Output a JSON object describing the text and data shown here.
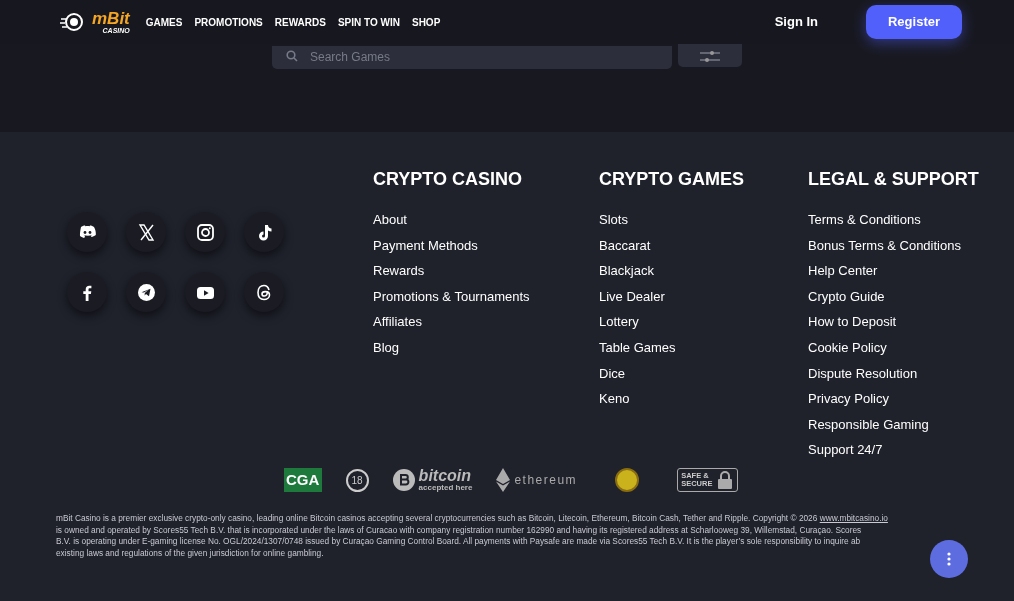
{
  "header": {
    "logo_text": "mBit",
    "logo_sub": "CASINO",
    "nav": [
      {
        "label": "GAMES"
      },
      {
        "label": "PROMOTIONS"
      },
      {
        "label": "REWARDS"
      },
      {
        "label": "SPIN TO WIN"
      },
      {
        "label": "SHOP"
      }
    ],
    "sign_in": "Sign In",
    "register": "Register"
  },
  "search": {
    "placeholder": "Search Games"
  },
  "socials": [
    {
      "kind": "discord"
    },
    {
      "kind": "x"
    },
    {
      "kind": "instagram"
    },
    {
      "kind": "tiktok"
    },
    {
      "kind": "facebook"
    },
    {
      "kind": "telegram"
    },
    {
      "kind": "youtube"
    },
    {
      "kind": "threads"
    }
  ],
  "columns": [
    {
      "title": "CRYPTO CASINO",
      "links": [
        "About",
        "Payment Methods",
        "Rewards",
        "Promotions & Tournaments",
        "Affiliates",
        "Blog"
      ]
    },
    {
      "title": "CRYPTO GAMES",
      "links": [
        "Slots",
        "Baccarat",
        "Blackjack",
        "Live Dealer",
        "Lottery",
        "Table Games",
        "Dice",
        "Keno"
      ]
    },
    {
      "title": "LEGAL & SUPPORT",
      "links": [
        "Terms & Conditions",
        "Bonus Terms & Conditions",
        "Help Center",
        "Crypto Guide",
        "How to Deposit",
        "Cookie Policy",
        "Dispute Resolution",
        "Privacy Policy",
        "Responsible Gaming",
        "Support 24/7"
      ]
    }
  ],
  "badges": [
    {
      "kind": "cga",
      "text": "CGA"
    },
    {
      "kind": "age",
      "text": "18"
    },
    {
      "kind": "bitcoin",
      "text": "bitcoin",
      "sub": "accepted here"
    },
    {
      "kind": "ethereum",
      "text": "ethereum"
    },
    {
      "kind": "seal"
    },
    {
      "kind": "safe",
      "text": "SAFE &",
      "sub": "SECURE"
    }
  ],
  "legal": {
    "lines": [
      "mBit Casino is a premier exclusive crypto-only casino, leading online Bitcoin casinos accepting several cryptocurrencies such as Bitcoin, Litecoin, Ethereum, Bitcoin Cash, Tether and Ripple. Copyright © 2026",
      "is owned and operated by Scores55 Tech B.V. that is incorporated under the laws of Curacao with company registration number 162990 and having its registered address at Scharlooweg 39, Willemstad, Curaçao. Scores",
      "B.V. is operating under E-gaming license No. OGL/2024/1307/0748 issued by Curaçao Gaming Control Board. All payments with Paysafe are made via Scores55 Tech B.V. It is the player’s sole responsibility to inquire ab",
      "existing laws and regulations of the given jurisdiction for online gambling."
    ],
    "link": "www.mbitcasino.io"
  }
}
